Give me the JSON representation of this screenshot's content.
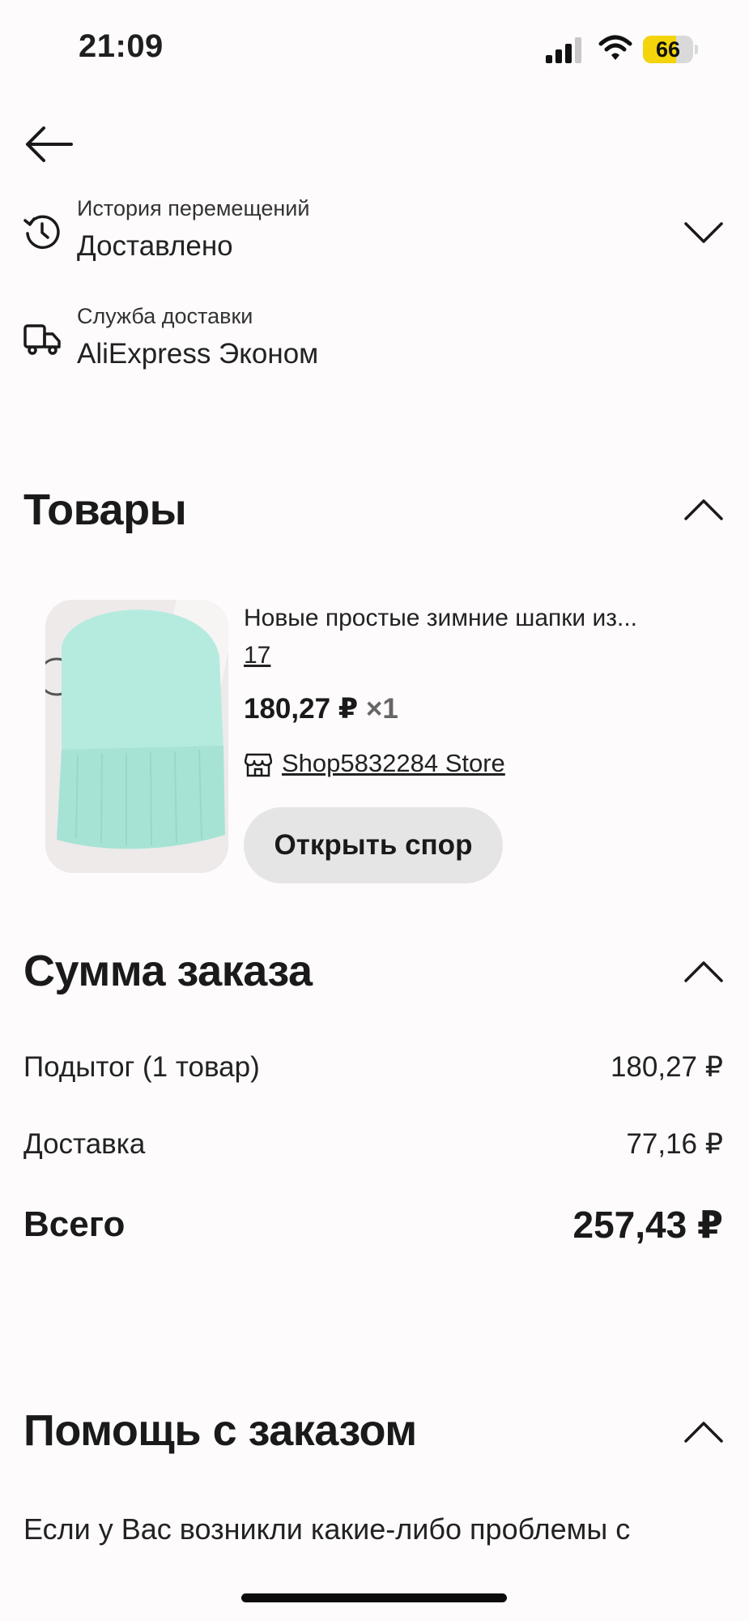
{
  "status_bar": {
    "time": "21:09",
    "battery": "66",
    "battery_level": 0.66
  },
  "tracking": {
    "history_label": "История перемещений",
    "history_value": "Доставлено",
    "service_label": "Служба доставки",
    "service_value": "AliExpress Эконом"
  },
  "products": {
    "title": "Товары",
    "item": {
      "name": "Новые простые зимние шапки из...",
      "variant": "17",
      "price": "180,27 ₽",
      "quantity": "×1",
      "store": "Shop5832284 Store",
      "dispute_label": "Открыть спор"
    }
  },
  "order_sum": {
    "title": "Сумма заказа",
    "subtotal_label": "Подытог (1 товар)",
    "subtotal_value": "180,27 ₽",
    "delivery_label": "Доставка",
    "delivery_value": "77,16 ₽",
    "total_label": "Всего",
    "total_value": "257,43 ₽"
  },
  "help": {
    "title": "Помощь с заказом",
    "text": "Если у Вас возникли какие-либо проблемы с"
  },
  "colors": {
    "background": "#fdfbfc",
    "battery_accent": "#f4d40a",
    "button_bg": "#e6e5e6",
    "product_color": "#a9e6d7"
  }
}
